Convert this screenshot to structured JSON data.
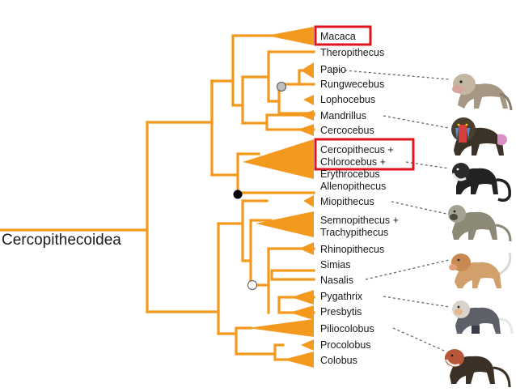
{
  "root_label": "Cercopithecoidea",
  "colors": {
    "branch": "#f39a1e",
    "leader": "#666666",
    "highlight": "#e0141c",
    "node_gray": "#bfbfbf",
    "node_black": "#000000",
    "node_white": "#ffffff"
  },
  "taxa": [
    {
      "id": "macaca",
      "label": "Macaca",
      "highlighted": true
    },
    {
      "id": "theropithecus",
      "label": "Theropithecus"
    },
    {
      "id": "papio",
      "label": "Papio",
      "icon": "baboon-icon"
    },
    {
      "id": "rungwecebus",
      "label": "Rungwecebus"
    },
    {
      "id": "lophocebus",
      "label": "Lophocebus"
    },
    {
      "id": "mandrillus",
      "label": "Mandrillus",
      "icon": "mandrill-icon"
    },
    {
      "id": "cercocebus",
      "label": "Cercocebus"
    },
    {
      "id": "cercopithecus",
      "label": "Cercopithecus +",
      "highlighted": true
    },
    {
      "id": "chlorocebus",
      "label": "Chlorocebus +",
      "highlighted": true,
      "icon": "guenon-icon"
    },
    {
      "id": "erythrocebus",
      "label": "Erythrocebus"
    },
    {
      "id": "allenopithecus",
      "label": "Allenopithecus"
    },
    {
      "id": "miopithecus",
      "label": "Miopithecus",
      "icon": "langur-icon"
    },
    {
      "id": "semnopithecus",
      "label": "Semnopithecus +"
    },
    {
      "id": "trachypithecus",
      "label": "Trachypithecus"
    },
    {
      "id": "rhinopithecus",
      "label": "Rhinopithecus"
    },
    {
      "id": "simias",
      "label": "Simias"
    },
    {
      "id": "nasalis",
      "label": "Nasalis",
      "icon": "proboscis-monkey-icon"
    },
    {
      "id": "pygathrix",
      "label": "Pygathrix",
      "icon": "douc-icon"
    },
    {
      "id": "presbytis",
      "label": "Presbytis"
    },
    {
      "id": "piliocolobus",
      "label": "Piliocolobus",
      "icon": "red-colobus-icon"
    },
    {
      "id": "procolobus",
      "label": "Procolobus"
    },
    {
      "id": "colobus",
      "label": "Colobus"
    }
  ]
}
